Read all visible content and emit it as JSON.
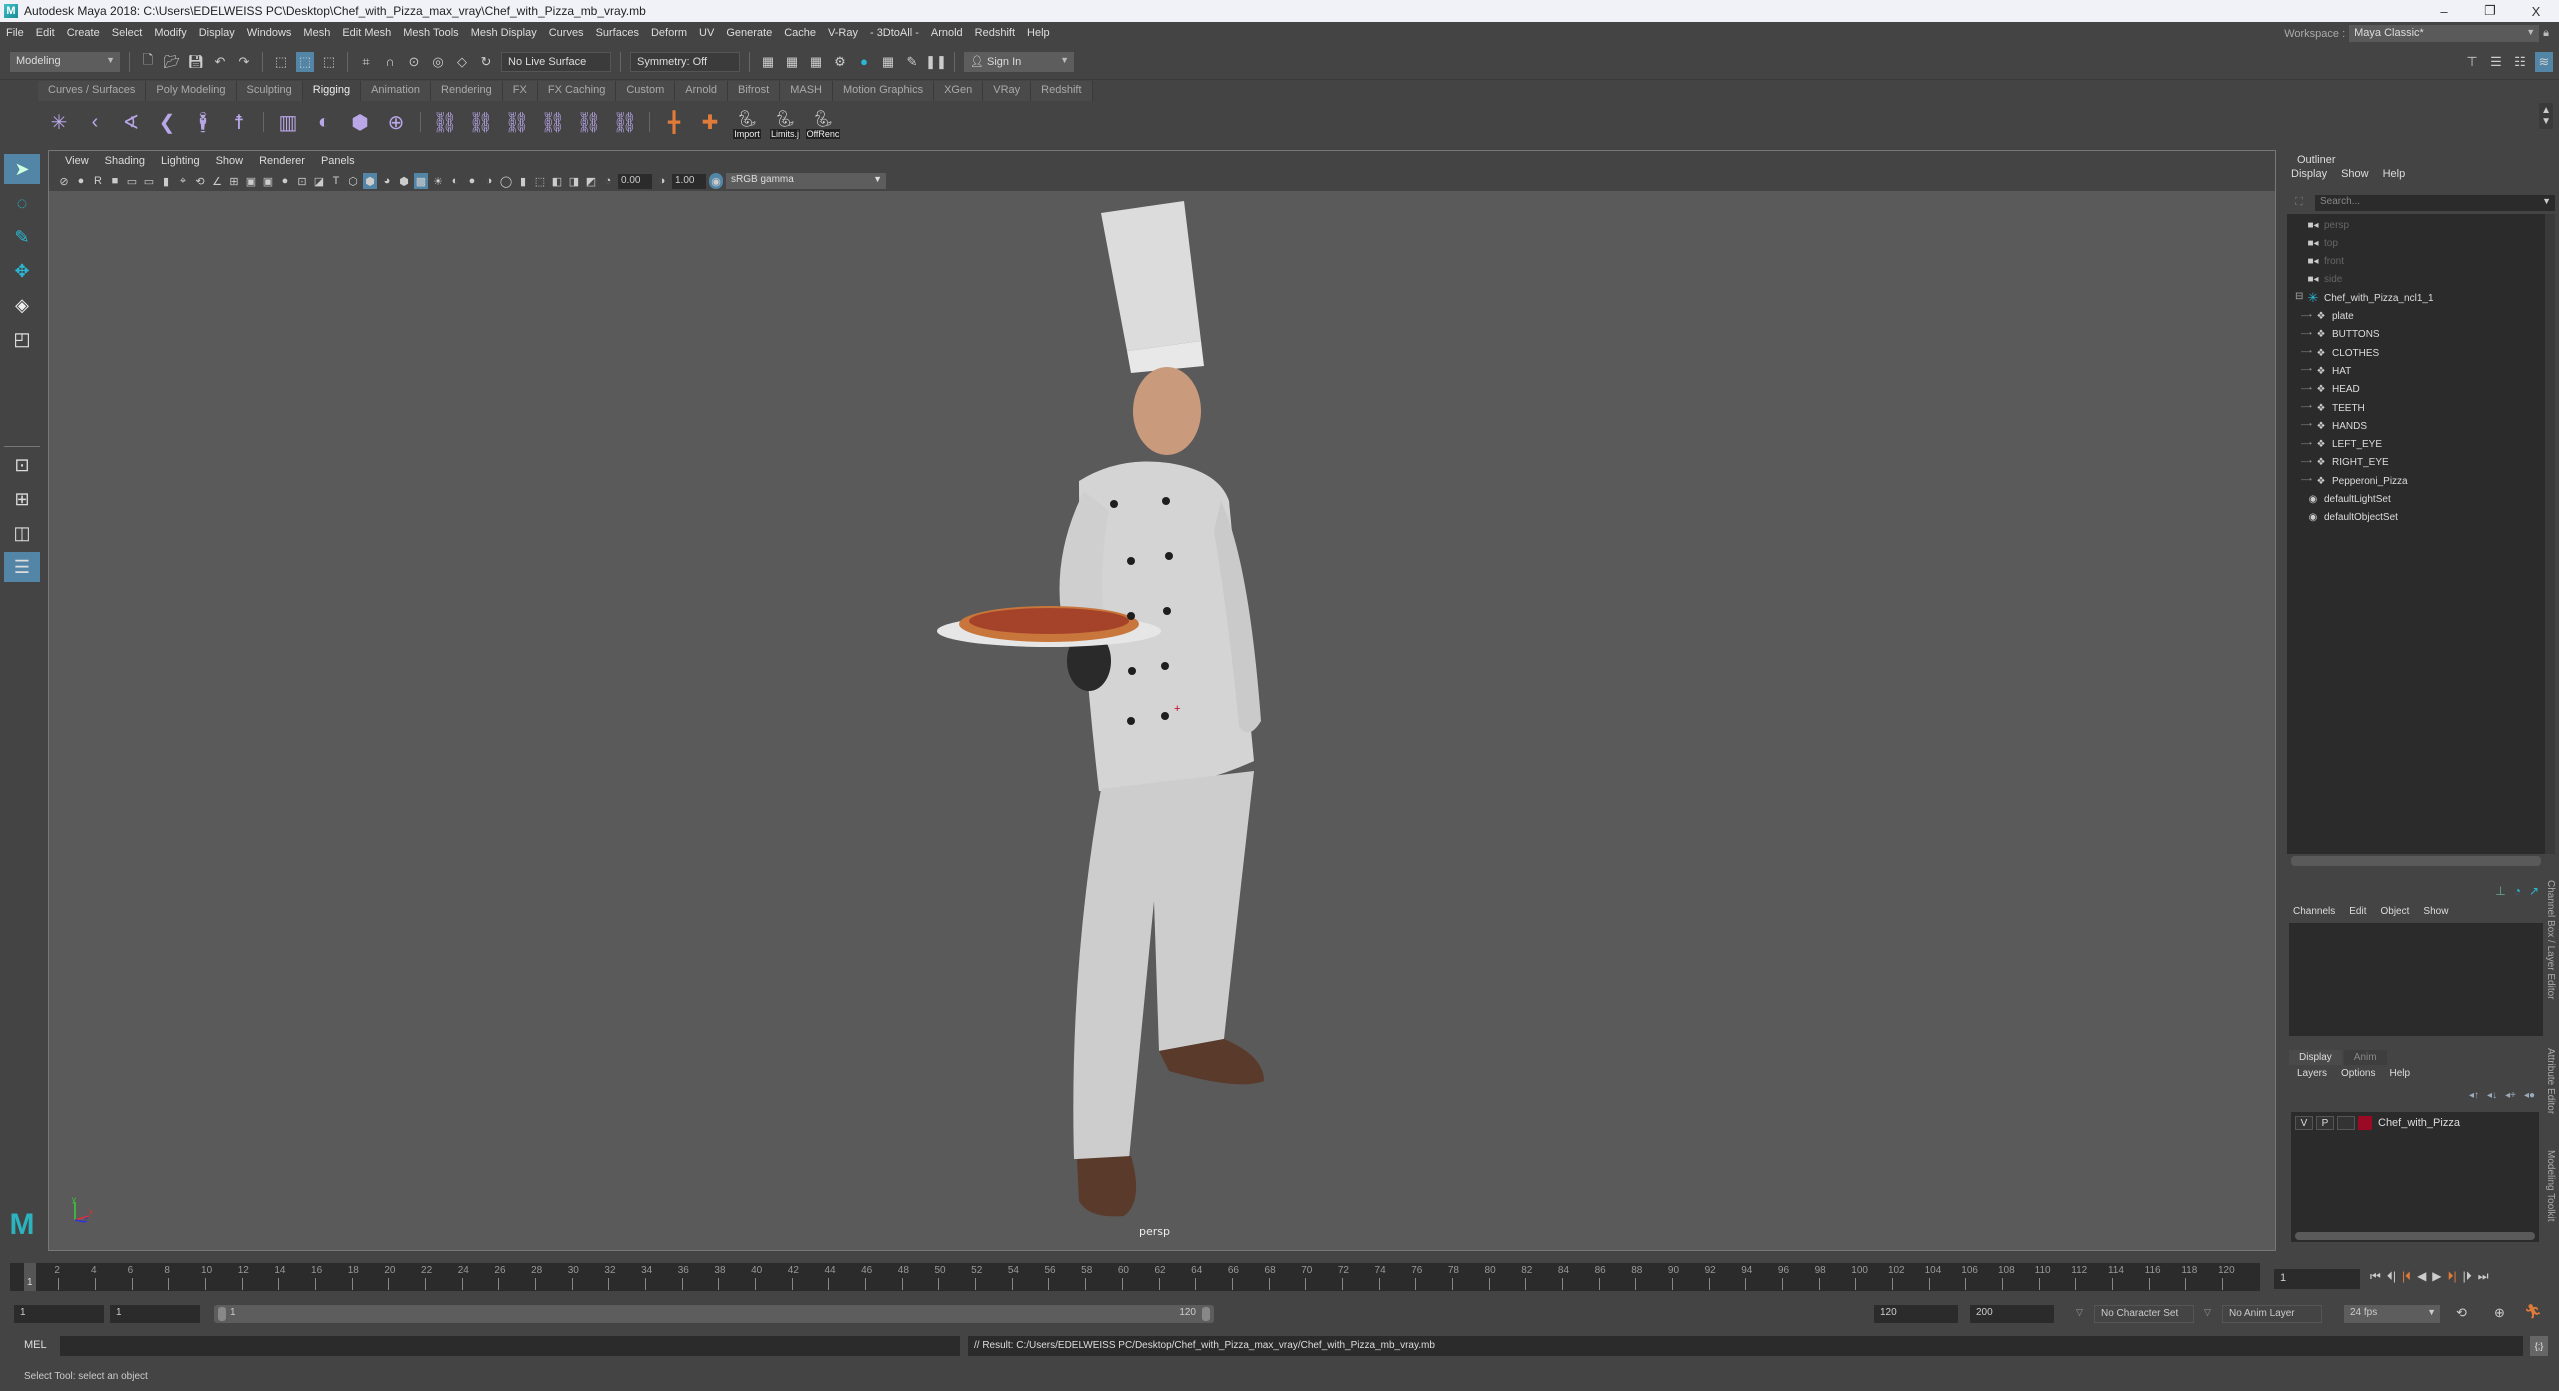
{
  "window": {
    "title": "Autodesk Maya 2018: C:\\Users\\EDELWEISS PC\\Desktop\\Chef_with_Pizza_max_vray\\Chef_with_Pizza_mb_vray.mb",
    "minimize": "–",
    "restore": "❐",
    "close": "X"
  },
  "menubar": [
    "File",
    "Edit",
    "Create",
    "Select",
    "Modify",
    "Display",
    "Windows",
    "Mesh",
    "Edit Mesh",
    "Mesh Tools",
    "Mesh Display",
    "Curves",
    "Surfaces",
    "Deform",
    "UV",
    "Generate",
    "Cache",
    "V-Ray",
    "- 3DtoAll -",
    "Arnold",
    "Redshift",
    "Help"
  ],
  "workspace": {
    "label": "Workspace :",
    "value": "Maya Classic*"
  },
  "statusline": {
    "mode": "Modeling",
    "live_surface": "No Live Surface",
    "symmetry": "Symmetry: Off",
    "sign_in": "Sign In"
  },
  "shelf": {
    "tabs": [
      "Curves / Surfaces",
      "Poly Modeling",
      "Sculpting",
      "Rigging",
      "Animation",
      "Rendering",
      "FX",
      "FX Caching",
      "Custom",
      "Arnold",
      "Bifrost",
      "MASH",
      "Motion Graphics",
      "XGen",
      "VRay",
      "Redshift"
    ],
    "active_tab": "Rigging",
    "python_buttons": [
      "Import",
      "Limits.j",
      "OffRenc"
    ]
  },
  "viewport": {
    "menu": [
      "View",
      "Shading",
      "Lighting",
      "Show",
      "Renderer",
      "Panels"
    ],
    "exposure": "0.00",
    "gamma": "1.00",
    "color_space": "sRGB gamma",
    "camera": "persp",
    "axis": {
      "x": "x",
      "y": "y",
      "z": "z"
    }
  },
  "outliner": {
    "title": "Outliner",
    "menu": [
      "Display",
      "Show",
      "Help"
    ],
    "search_placeholder": "Search...",
    "cameras": [
      "persp",
      "top",
      "front",
      "side"
    ],
    "root": "Chef_with_Pizza_ncl1_1",
    "children": [
      "plate",
      "BUTTONS",
      "CLOTHES",
      "HAT",
      "HEAD",
      "TEETH",
      "HANDS",
      "LEFT_EYE",
      "RIGHT_EYE",
      "Pepperoni_Pizza"
    ],
    "sets": [
      "defaultLightSet",
      "defaultObjectSet"
    ]
  },
  "channel_box": {
    "menu": [
      "Channels",
      "Edit",
      "Object",
      "Show"
    ],
    "layer_tabs": [
      "Display",
      "Anim"
    ],
    "layer_menu": [
      "Layers",
      "Options",
      "Help"
    ],
    "layer": {
      "v": "V",
      "p": "P",
      "name": "Chef_with_Pizza",
      "color": "#9b0a24"
    }
  },
  "side_tabs": [
    "Channel Box / Layer Editor",
    "Attribute Editor",
    "Modeling Toolkit"
  ],
  "timeline": {
    "ticks": [
      2,
      4,
      6,
      8,
      10,
      12,
      14,
      16,
      18,
      20,
      22,
      24,
      26,
      28,
      30,
      32,
      34,
      36,
      38,
      40,
      42,
      44,
      46,
      48,
      50,
      52,
      54,
      56,
      58,
      60,
      62,
      64,
      66,
      68,
      70,
      72,
      74,
      76,
      78,
      80,
      82,
      84,
      86,
      88,
      90,
      92,
      94,
      96,
      98,
      100,
      102,
      104,
      106,
      108,
      110,
      112,
      114,
      116,
      118,
      120
    ],
    "current_frame_marker": "1",
    "current_frame": "1"
  },
  "range": {
    "start": "1",
    "playback_start": "1",
    "slider_start": "1",
    "slider_end": "120",
    "playback_end": "120",
    "end": "200",
    "character_set": "No Character Set",
    "anim_layer": "No Anim Layer",
    "fps": "24 fps"
  },
  "command": {
    "label": "MEL",
    "result": "// Result: C:/Users/EDELWEISS PC/Desktop/Chef_with_Pizza_max_vray/Chef_with_Pizza_mb_vray.mb"
  },
  "help_line": "Select Tool: select an object"
}
